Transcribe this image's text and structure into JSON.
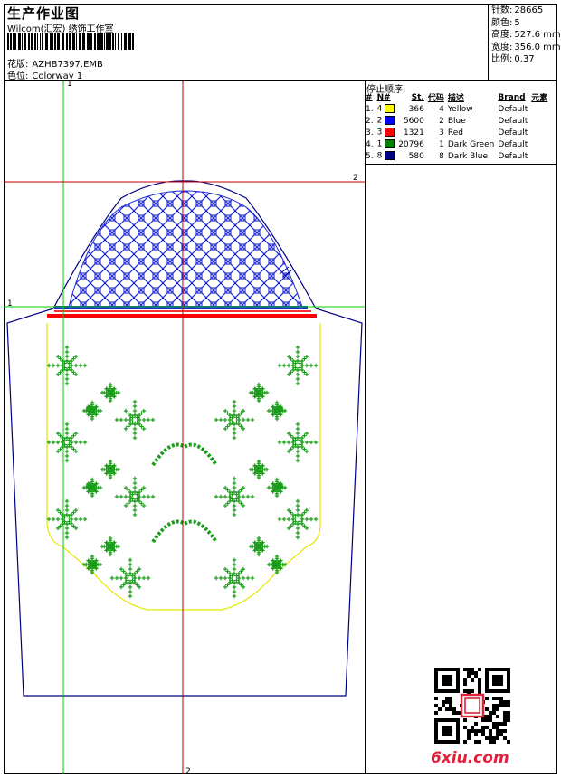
{
  "header": {
    "title": "生产作业图",
    "company": "Wilcom(汇宏) 绣饰工作室",
    "design_label": "花版:",
    "design_value": "AZHB7397.EMB",
    "colorway_label": "色位:",
    "colorway_value": "Colorway 1"
  },
  "stats": [
    {
      "label": "针数:",
      "value": "28665"
    },
    {
      "label": "颜色:",
      "value": "5"
    },
    {
      "label": "高度:",
      "value": "527.6 mm"
    },
    {
      "label": "宽度:",
      "value": "356.0 mm"
    },
    {
      "label": "比例:",
      "value": "0.37"
    }
  ],
  "legend": {
    "title": "停止顺序:",
    "columns": [
      "#",
      "N#",
      "St.",
      "代码",
      "描述",
      "Brand",
      "元素"
    ],
    "rows": [
      {
        "index": "1.",
        "needle": "4",
        "color": "#ffff00",
        "stitches": "366",
        "code": "4",
        "desc": "Yellow",
        "brand": "Default"
      },
      {
        "index": "2.",
        "needle": "2",
        "color": "#0000ff",
        "stitches": "5600",
        "code": "2",
        "desc": "Blue",
        "brand": "Default"
      },
      {
        "index": "3.",
        "needle": "3",
        "color": "#ff0000",
        "stitches": "1321",
        "code": "3",
        "desc": "Red",
        "brand": "Default"
      },
      {
        "index": "4.",
        "needle": "1",
        "color": "#008000",
        "stitches": "20796",
        "code": "1",
        "desc": "Dark Green",
        "brand": "Default"
      },
      {
        "index": "5.",
        "needle": "8",
        "color": "#000080",
        "stitches": "580",
        "code": "8",
        "desc": "Dark Blue",
        "brand": "Default"
      }
    ]
  },
  "guides": {
    "v1": "1",
    "v2": "2",
    "h1": "1",
    "h2": "2"
  },
  "watermark": "6xiu.com",
  "colors": {
    "guide_green": "#00cc00",
    "guide_red": "#cc0000",
    "outline": "#000080",
    "motif": "#1a9e1a"
  }
}
